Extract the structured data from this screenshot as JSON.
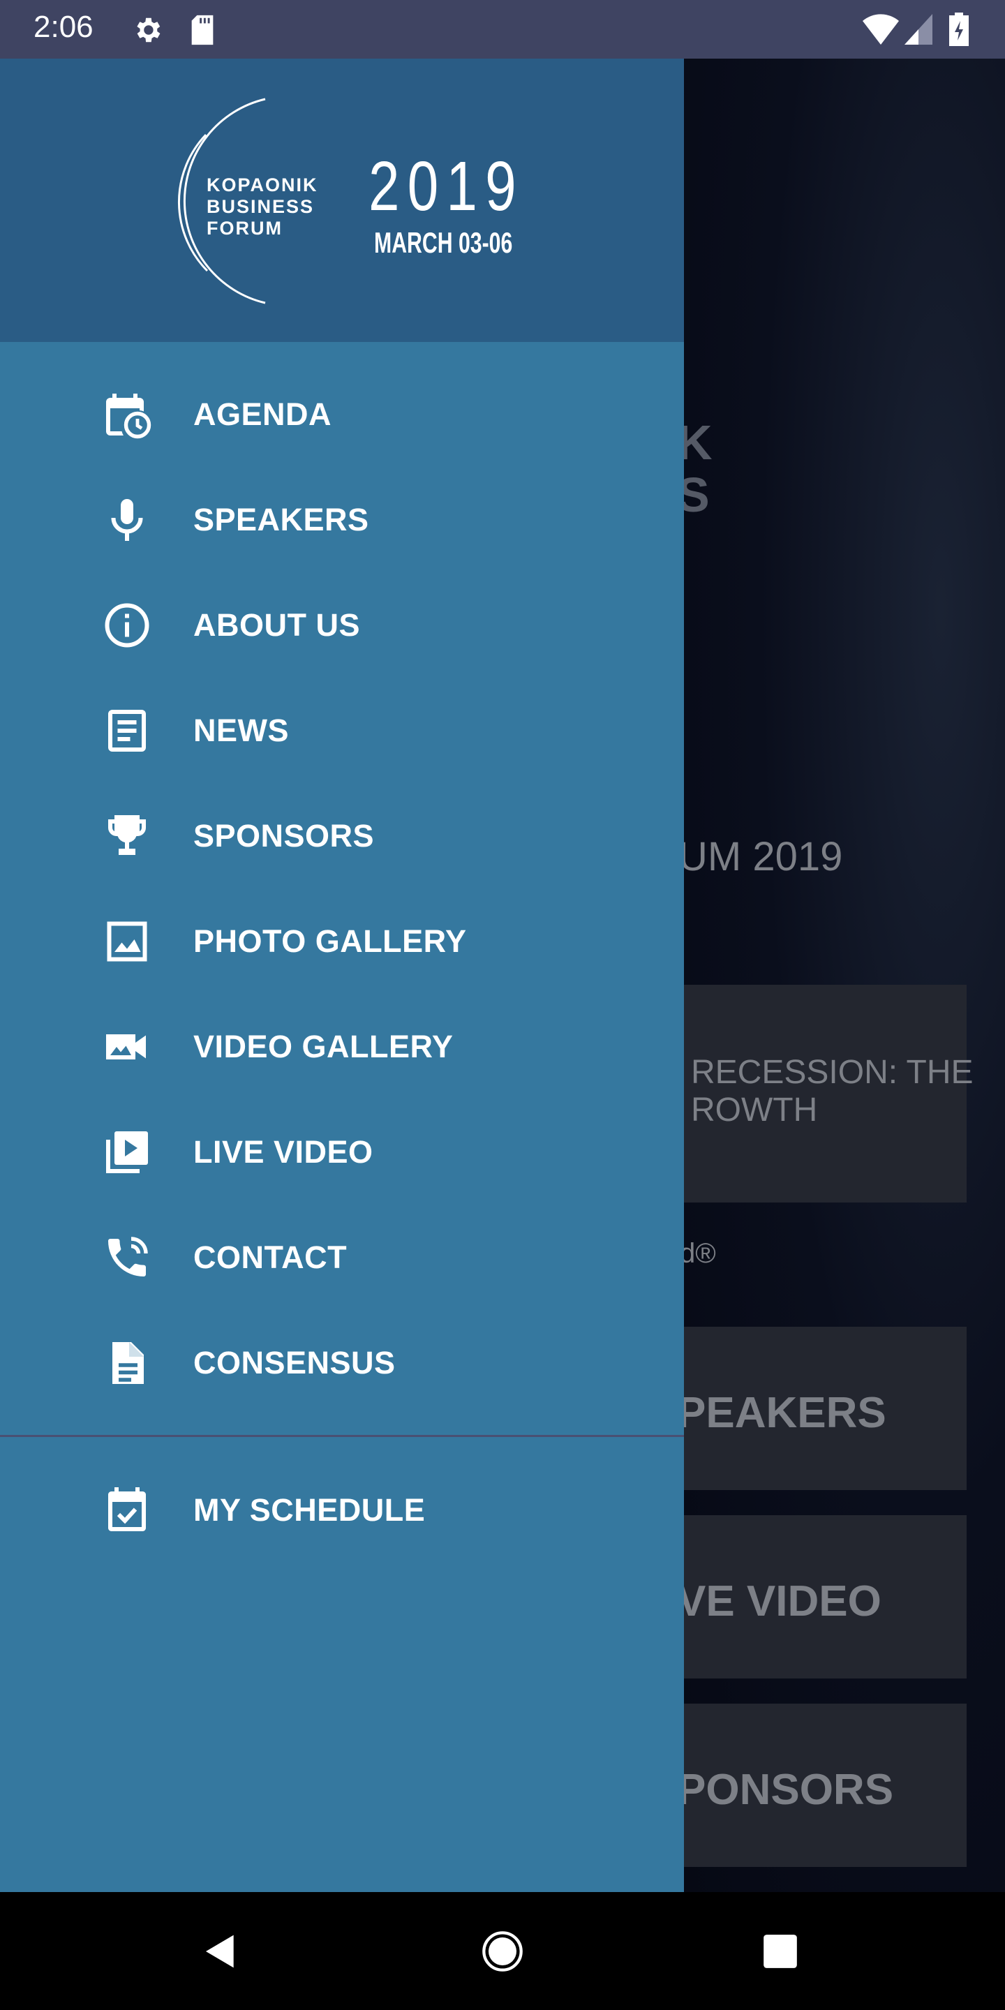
{
  "status_bar": {
    "time": "2:06",
    "icons": [
      "settings-icon",
      "sd-card-icon",
      "wifi-icon",
      "signal-icon",
      "battery-charging-icon"
    ]
  },
  "drawer": {
    "logo": {
      "line1": "KOPAONIK",
      "line2": "BUSINESS",
      "line3": "FORUM",
      "year": "2019",
      "dates": "MARCH 03-06"
    },
    "items": [
      {
        "label": "AGENDA",
        "icon": "calendar-clock-icon"
      },
      {
        "label": "SPEAKERS",
        "icon": "microphone-icon"
      },
      {
        "label": "ABOUT US",
        "icon": "info-icon"
      },
      {
        "label": "NEWS",
        "icon": "article-icon"
      },
      {
        "label": "SPONSORS",
        "icon": "trophy-icon"
      },
      {
        "label": "PHOTO GALLERY",
        "icon": "image-icon"
      },
      {
        "label": "VIDEO GALLERY",
        "icon": "video-camera-icon"
      },
      {
        "label": "LIVE VIDEO",
        "icon": "video-library-icon"
      },
      {
        "label": "CONTACT",
        "icon": "phone-icon"
      },
      {
        "label": "CONSENSUS",
        "icon": "document-icon"
      }
    ],
    "secondary": [
      {
        "label": "MY SCHEDULE",
        "icon": "calendar-check-icon"
      }
    ]
  },
  "background": {
    "logo_partial_1": "K",
    "logo_partial_2": "S",
    "title_partial": "UM 2019",
    "headline_partial_1": "RECESSION: THE",
    "headline_partial_2": "ROWTH",
    "credit_partial": "d®",
    "buttons": [
      "PEAKERS",
      "VE VIDEO",
      "PONSORS"
    ]
  },
  "colors": {
    "drawer": "#35789f",
    "header": "#2a5c85",
    "status_bar": "#3f4462"
  }
}
